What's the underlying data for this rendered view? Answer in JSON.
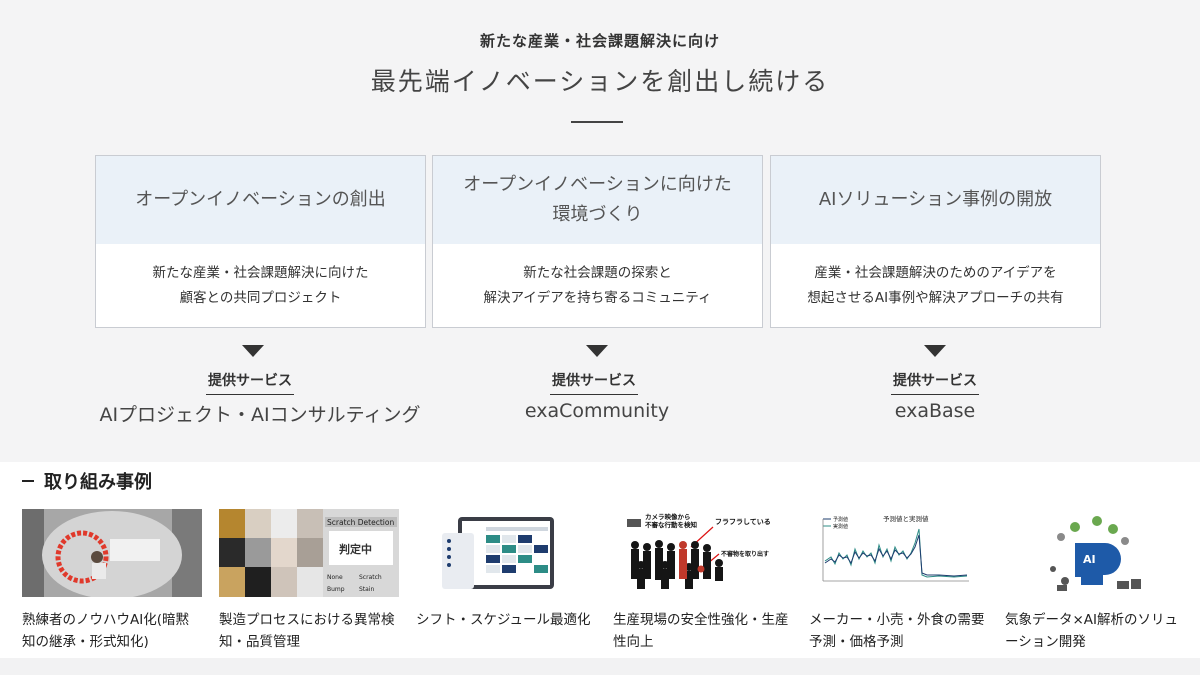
{
  "header": {
    "eyebrow": "新たな産業・社会課題解決に向け",
    "headline": "最先端イノベーションを創出し続ける"
  },
  "pillars": [
    {
      "title": "オープンイノベーションの創出",
      "description": "新たな産業・社会課題解決に向けた\n顧客との共同プロジェクト",
      "service_label": "提供サービス",
      "service_name": "AIプロジェクト・AIコンサルティング"
    },
    {
      "title": "オープンイノベーションに向けた\n環境づくり",
      "description": "新たな社会課題の探索と\n解決アイデアを持ち寄るコミュニティ",
      "service_label": "提供サービス",
      "service_name": "exaCommunity"
    },
    {
      "title": "AIソリューション事例の開放",
      "description": "産業・社会課題解決のためのアイデアを\n想起させるAI事例や解決アプローチの共有",
      "service_label": "提供サービス",
      "service_name": "exaBase"
    }
  ],
  "cases_section": {
    "title": "取り組み事例",
    "items": [
      {
        "caption": "熟練者のノウハウAI化(暗黙知の継承・形式知化)"
      },
      {
        "caption": "製造プロセスにおける異常検知・品質管理",
        "thumb_text": [
          "Scratch Detection",
          "判定中",
          "None",
          "Scratch",
          "Bump",
          "Stain"
        ]
      },
      {
        "caption": "シフト・スケジュール最適化"
      },
      {
        "caption": "生産現場の安全性強化・生産性向上",
        "thumb_text": [
          "カメラ映像から",
          "不審な行動を検知",
          "フラフラしている",
          "不審物を取り出す"
        ]
      },
      {
        "caption": "メーカー・小売・外食の需要予測・価格予測",
        "thumb_text": [
          "予測値と実測値",
          "予測値",
          "実測値"
        ]
      },
      {
        "caption": "気象データ×AI解析のソリューション開発",
        "thumb_text": [
          "AI"
        ]
      }
    ]
  },
  "colors": {
    "card_head_bg": "#eaf1f8",
    "page_bg": "#f4f4f5",
    "accent_teal": "#2d8c86",
    "navy": "#1e3c6e"
  }
}
